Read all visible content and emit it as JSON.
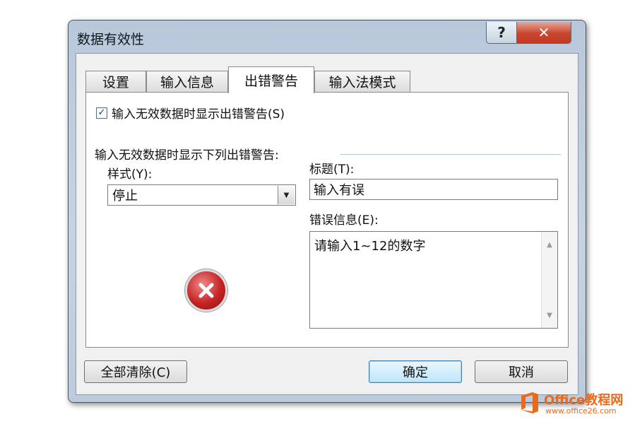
{
  "window": {
    "title": "数据有效性",
    "help_label": "?",
    "close_label": "✕"
  },
  "tabs": [
    {
      "label": "设置"
    },
    {
      "label": "输入信息"
    },
    {
      "label": "出错警告"
    },
    {
      "label": "输入法模式"
    }
  ],
  "active_tab": "出错警告",
  "error_alert": {
    "show_checkbox_label": "输入无效数据时显示出错警告(S)",
    "show_checkbox_checked": true,
    "checkmark": "✓",
    "section_label": "输入无效数据时显示下列出错警告:",
    "style_label": "样式(Y):",
    "style_value": "停止",
    "style_icon": "stop-error-icon",
    "title_label": "标题(T):",
    "title_value": "输入有误",
    "message_label": "错误信息(E):",
    "message_value": "请输入1~12的数字"
  },
  "buttons": {
    "clear_all": "全部清除(C)",
    "ok": "确定",
    "cancel": "取消"
  },
  "watermark": {
    "line1": "Office教程网",
    "line2": "www.office26.com"
  },
  "colors": {
    "accent": "#3c7fb1",
    "close": "#c8442c",
    "error": "#c42424",
    "watermark": "#e86a1a"
  }
}
